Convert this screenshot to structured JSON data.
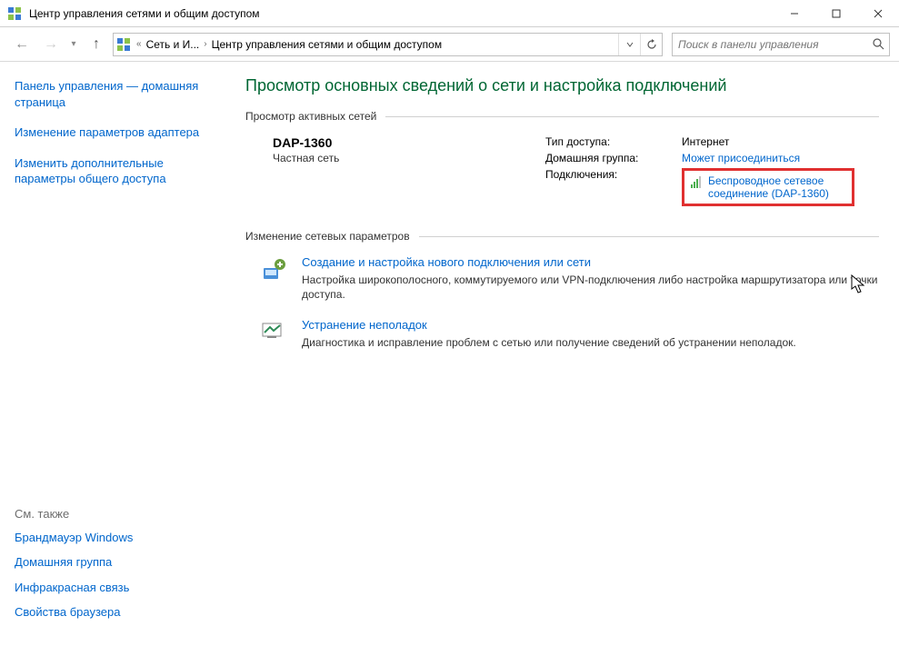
{
  "window": {
    "title": "Центр управления сетями и общим доступом"
  },
  "breadcrumb": {
    "root": "Сеть и И...",
    "current": "Центр управления сетями и общим доступом"
  },
  "search": {
    "placeholder": "Поиск в панели управления"
  },
  "sidebar": {
    "links": [
      "Панель управления — домашняя страница",
      "Изменение параметров адаптера",
      "Изменить дополнительные параметры общего доступа"
    ],
    "see_also_header": "См. также",
    "see_also": [
      "Брандмауэр Windows",
      "Домашняя группа",
      "Инфракрасная связь",
      "Свойства браузера"
    ]
  },
  "content": {
    "heading": "Просмотр основных сведений о сети и настройка подключений",
    "section_active": "Просмотр активных сетей",
    "network": {
      "name": "DAP-1360",
      "type": "Частная сеть"
    },
    "details": {
      "access_label": "Тип доступа:",
      "access_value": "Интернет",
      "homegroup_label": "Домашняя группа:",
      "homegroup_value": "Может присоединиться",
      "connections_label": "Подключения:",
      "connections_value": "Беспроводное сетевое соединение (DAP-1360)"
    },
    "section_change": "Изменение сетевых параметров",
    "action_new": {
      "title": "Создание и настройка нового подключения или сети",
      "desc": "Настройка широкополосного, коммутируемого или VPN-подключения либо настройка маршрутизатора или точки доступа."
    },
    "action_troubleshoot": {
      "title": "Устранение неполадок",
      "desc": "Диагностика и исправление проблем с сетью или получение сведений об устранении неполадок."
    }
  }
}
